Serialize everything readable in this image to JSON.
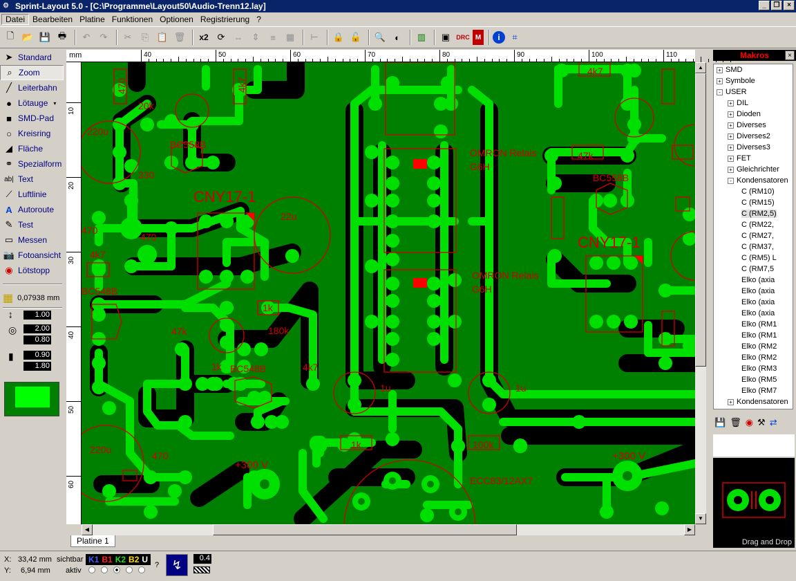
{
  "window": {
    "title": "Sprint-Layout 5.0 - [C:\\Programme\\Layout50\\Audio-Trenn12.lay]"
  },
  "menu": [
    "Datei",
    "Bearbeiten",
    "Platine",
    "Funktionen",
    "Optionen",
    "Registrierung",
    "?"
  ],
  "toolbar": {
    "zoom_label": "x2"
  },
  "tools": [
    "Standard",
    "Zoom",
    "Leiterbahn",
    "Lötauge",
    "SMD-Pad",
    "Kreisring",
    "Fläche",
    "Spezialform",
    "Text",
    "Luftlinie",
    "Autoroute",
    "Test",
    "Messen",
    "Fotoansicht",
    "Lötstopp"
  ],
  "active_tool": "Zoom",
  "grid": {
    "value": "0,07938 mm"
  },
  "settings": {
    "track_width": "1.00",
    "pad_outer": "2.00",
    "pad_inner": "0.80",
    "smd_w": "0.90",
    "smd_h": "1.80"
  },
  "ruler": {
    "unit": "mm",
    "top_ticks": [
      "40",
      "50",
      "60",
      "70",
      "80",
      "90",
      "100",
      "110"
    ],
    "left_ticks": [
      "10",
      "20",
      "30",
      "40",
      "50",
      "60"
    ]
  },
  "board_labels": {
    "r1": "470",
    "r2": "20k",
    "r3": "4k7",
    "c1": "220u",
    "t1": "BC558B",
    "r4": "330",
    "opto1": "CNY17-1",
    "c2": "22u",
    "r5": "470",
    "r6": "470",
    "r7": "4k7",
    "t2": "BC548B",
    "r8": "1k",
    "r9": "47k",
    "r10": "180k",
    "r11": "1k",
    "t3": "BC548B",
    "r12": "4k7",
    "relay1": "OMRON Relais",
    "relay1b": "G6H",
    "relay2": "OMRON Relais",
    "relay2b": "G6H",
    "c3": "1u",
    "c4": "1u",
    "r13": "4k7",
    "r14": "47k",
    "t4": "BC558B",
    "opto2": "CNY17-1",
    "r15": "1k",
    "r16": "100k",
    "hv1": "+300 V",
    "hv2": "+300 V",
    "tube": "ECC83/12AX7",
    "c5": "220u",
    "r17": "470"
  },
  "tab": {
    "name": "Platine 1"
  },
  "makros": {
    "title": "Makros",
    "tree": [
      {
        "label": "SMD",
        "level": 0,
        "exp": "+"
      },
      {
        "label": "Symbole",
        "level": 0,
        "exp": "+"
      },
      {
        "label": "USER",
        "level": 0,
        "exp": "-"
      },
      {
        "label": "DIL",
        "level": 1,
        "exp": "+"
      },
      {
        "label": "Dioden",
        "level": 1,
        "exp": "+"
      },
      {
        "label": "Diverses",
        "level": 1,
        "exp": "+"
      },
      {
        "label": "Diverses2",
        "level": 1,
        "exp": "+"
      },
      {
        "label": "Diverses3",
        "level": 1,
        "exp": "+"
      },
      {
        "label": "FET",
        "level": 1,
        "exp": "+"
      },
      {
        "label": "Gleichrichter",
        "level": 1,
        "exp": "+"
      },
      {
        "label": "Kondensatoren",
        "level": 1,
        "exp": "-"
      },
      {
        "label": "C (RM10)",
        "level": 2,
        "exp": ""
      },
      {
        "label": "C (RM15)",
        "level": 2,
        "exp": ""
      },
      {
        "label": "C (RM2,5)",
        "level": 2,
        "exp": "",
        "selected": true
      },
      {
        "label": "C (RM22,",
        "level": 2,
        "exp": ""
      },
      {
        "label": "C (RM27,",
        "level": 2,
        "exp": ""
      },
      {
        "label": "C (RM37,",
        "level": 2,
        "exp": ""
      },
      {
        "label": "C (RM5) L",
        "level": 2,
        "exp": ""
      },
      {
        "label": "C (RM7,5",
        "level": 2,
        "exp": ""
      },
      {
        "label": "Elko (axia",
        "level": 2,
        "exp": ""
      },
      {
        "label": "Elko (axia",
        "level": 2,
        "exp": ""
      },
      {
        "label": "Elko (axia",
        "level": 2,
        "exp": ""
      },
      {
        "label": "Elko (axia",
        "level": 2,
        "exp": ""
      },
      {
        "label": "Elko (RM1",
        "level": 2,
        "exp": ""
      },
      {
        "label": "Elko (RM1",
        "level": 2,
        "exp": ""
      },
      {
        "label": "Elko (RM2",
        "level": 2,
        "exp": ""
      },
      {
        "label": "Elko (RM2",
        "level": 2,
        "exp": ""
      },
      {
        "label": "Elko (RM3",
        "level": 2,
        "exp": ""
      },
      {
        "label": "Elko (RM5",
        "level": 2,
        "exp": ""
      },
      {
        "label": "Elko (RM7",
        "level": 2,
        "exp": ""
      },
      {
        "label": "Kondensatoren",
        "level": 1,
        "exp": "+"
      }
    ],
    "drag_drop": "Drag and Drop"
  },
  "status": {
    "x_label": "X:",
    "x_value": "33,42 mm",
    "y_label": "Y:",
    "y_value": "6,94 mm",
    "sichtbar": "sichtbar",
    "aktiv": "aktiv",
    "layers": [
      {
        "name": "K1",
        "color": "#4060ff"
      },
      {
        "name": "B1",
        "color": "#ff2020"
      },
      {
        "name": "K2",
        "color": "#20e020"
      },
      {
        "name": "B2",
        "color": "#ffe000"
      },
      {
        "name": "U",
        "color": "#ffffff"
      }
    ],
    "question": "?",
    "line_width": "0.4"
  }
}
